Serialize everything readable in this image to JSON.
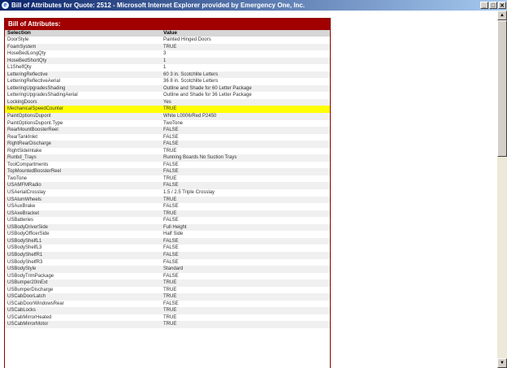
{
  "window": {
    "title": "Bill of Attributes for Quote: 2512 - Microsoft Internet Explorer provided by Emergency One, Inc.",
    "icon": "ie-icon",
    "buttons": {
      "minimize": "_",
      "maximize": "□",
      "close": "✕"
    }
  },
  "panel": {
    "header": "Bill of Attributes:",
    "columns": [
      "Selection",
      "Value"
    ]
  },
  "highlight_color": "#ffff00",
  "rows": [
    {
      "selection": "DoorStyle",
      "value": "Painted Hinged Doors"
    },
    {
      "selection": "FoamSystem",
      "value": "TRUE"
    },
    {
      "selection": "HoseBedLongQty",
      "value": "3"
    },
    {
      "selection": "HoseBedShortQty",
      "value": "1"
    },
    {
      "selection": "L1ShelfQty",
      "value": "1"
    },
    {
      "selection": "LetteringReflective",
      "value": "60 3 in. Scotchlite Letters"
    },
    {
      "selection": "LetteringReflectiveAerial",
      "value": "36 8 in. Scotchlite Letters"
    },
    {
      "selection": "LetteringUpgradesShading",
      "value": "Outline and Shade for 60 Letter Package"
    },
    {
      "selection": "LetteringUpgradesShadingAerial",
      "value": "Outline and Shade for 36 Letter Package"
    },
    {
      "selection": "LockingDoors",
      "value": "Yes"
    },
    {
      "selection": "MechanicalSpeedCounter",
      "value": "TRUE",
      "highlight": true
    },
    {
      "selection": "PaintOptionsDupont",
      "value": "White L0006/Red P2450"
    },
    {
      "selection": "PaintOptionsDupont.Type",
      "value": "TwoTone"
    },
    {
      "selection": "RearMountBoosterReel",
      "value": "FALSE"
    },
    {
      "selection": "RearTankInlet",
      "value": "FALSE"
    },
    {
      "selection": "RightRearDischarge",
      "value": "FALSE"
    },
    {
      "selection": "RightSideIntake",
      "value": "TRUE"
    },
    {
      "selection": "Runbd_Trays",
      "value": "Running Boards No Suction Trays"
    },
    {
      "selection": "ToolCompartments",
      "value": "FALSE"
    },
    {
      "selection": "TopMountedBoosterReel",
      "value": "FALSE"
    },
    {
      "selection": "TwoTone",
      "value": "TRUE"
    },
    {
      "selection": "USAMFMRadio",
      "value": "FALSE"
    },
    {
      "selection": "USAerialCrosslay",
      "value": "1.5 / 2.5 Triple Crosslay"
    },
    {
      "selection": "USAlumWheels",
      "value": "TRUE"
    },
    {
      "selection": "USAuxBrake",
      "value": "FALSE"
    },
    {
      "selection": "USAxeBracket",
      "value": "TRUE"
    },
    {
      "selection": "USBatteries",
      "value": "FALSE"
    },
    {
      "selection": "USBodyDriverSide",
      "value": "Full Height"
    },
    {
      "selection": "USBodyOfficerSide",
      "value": "Half Side"
    },
    {
      "selection": "USBodyShelfL1",
      "value": "FALSE"
    },
    {
      "selection": "USBodyShelfL3",
      "value": "FALSE"
    },
    {
      "selection": "USBodyShelfR1",
      "value": "FALSE"
    },
    {
      "selection": "USBodyShelfR3",
      "value": "FALSE"
    },
    {
      "selection": "USBodyStyle",
      "value": "Standard"
    },
    {
      "selection": "USBodyTrimPackage",
      "value": "FALSE"
    },
    {
      "selection": "USBumper20InExt",
      "value": "TRUE"
    },
    {
      "selection": "USBumperDischarge",
      "value": "TRUE"
    },
    {
      "selection": "USCabDoorLatch",
      "value": "TRUE"
    },
    {
      "selection": "USCabDoorWindowsRear",
      "value": "FALSE"
    },
    {
      "selection": "USCabLocks",
      "value": "TRUE"
    },
    {
      "selection": "USCabMirrorHeated",
      "value": "TRUE"
    },
    {
      "selection": "USCabMirrorMotor",
      "value": "TRUE"
    }
  ]
}
